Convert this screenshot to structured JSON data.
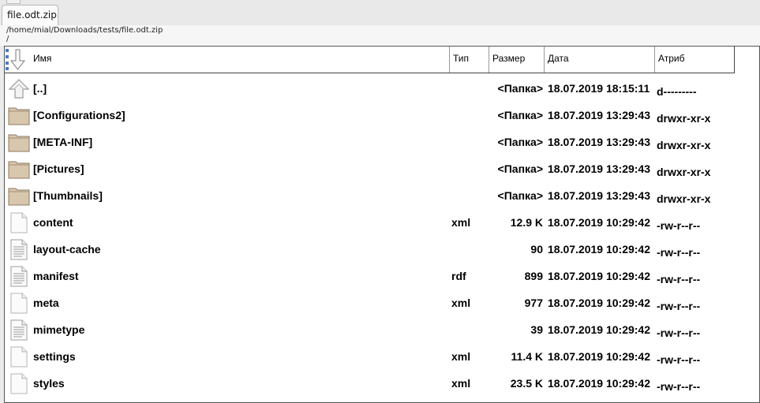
{
  "tabs": [
    {
      "label": "file.odt.zip"
    }
  ],
  "path": {
    "full": "/home/mial/Downloads/tests/file.odt.zip",
    "inner": "/"
  },
  "columns": {
    "name": "Имя",
    "type": "Тип",
    "size": "Размер",
    "date": "Дата",
    "attr": "Атриб"
  },
  "files": [
    {
      "name": "[..]",
      "type": "",
      "size": "<Папка>",
      "date": "18.07.2019 18:15:11",
      "attr": "d---------",
      "icon": "up-arrow-icon"
    },
    {
      "name": "[Configurations2]",
      "type": "",
      "size": "<Папка>",
      "date": "18.07.2019 13:29:43",
      "attr": "drwxr-xr-x",
      "icon": "folder-icon"
    },
    {
      "name": "[META-INF]",
      "type": "",
      "size": "<Папка>",
      "date": "18.07.2019 13:29:43",
      "attr": "drwxr-xr-x",
      "icon": "folder-icon"
    },
    {
      "name": "[Pictures]",
      "type": "",
      "size": "<Папка>",
      "date": "18.07.2019 13:29:43",
      "attr": "drwxr-xr-x",
      "icon": "folder-icon"
    },
    {
      "name": "[Thumbnails]",
      "type": "",
      "size": "<Папка>",
      "date": "18.07.2019 13:29:43",
      "attr": "drwxr-xr-x",
      "icon": "folder-icon"
    },
    {
      "name": "content",
      "type": "xml",
      "size": "12.9 K",
      "date": "18.07.2019 10:29:42",
      "attr": "-rw-r--r--",
      "icon": "blank-file-icon"
    },
    {
      "name": "layout-cache",
      "type": "",
      "size": "90",
      "date": "18.07.2019 10:29:42",
      "attr": "-rw-r--r--",
      "icon": "text-file-icon"
    },
    {
      "name": "manifest",
      "type": "rdf",
      "size": "899",
      "date": "18.07.2019 10:29:42",
      "attr": "-rw-r--r--",
      "icon": "text-file-icon"
    },
    {
      "name": "meta",
      "type": "xml",
      "size": "977",
      "date": "18.07.2019 10:29:42",
      "attr": "-rw-r--r--",
      "icon": "blank-file-icon"
    },
    {
      "name": "mimetype",
      "type": "",
      "size": "39",
      "date": "18.07.2019 10:29:42",
      "attr": "-rw-r--r--",
      "icon": "text-file-icon"
    },
    {
      "name": "settings",
      "type": "xml",
      "size": "11.4 K",
      "date": "18.07.2019 10:29:42",
      "attr": "-rw-r--r--",
      "icon": "blank-file-icon"
    },
    {
      "name": "styles",
      "type": "xml",
      "size": "23.5 K",
      "date": "18.07.2019 10:29:42",
      "attr": "-rw-r--r--",
      "icon": "blank-file-icon"
    }
  ],
  "colors": {
    "folder": "#d9c7ad",
    "folder_border": "#8d7a63",
    "accent": "#3b6fc4"
  }
}
